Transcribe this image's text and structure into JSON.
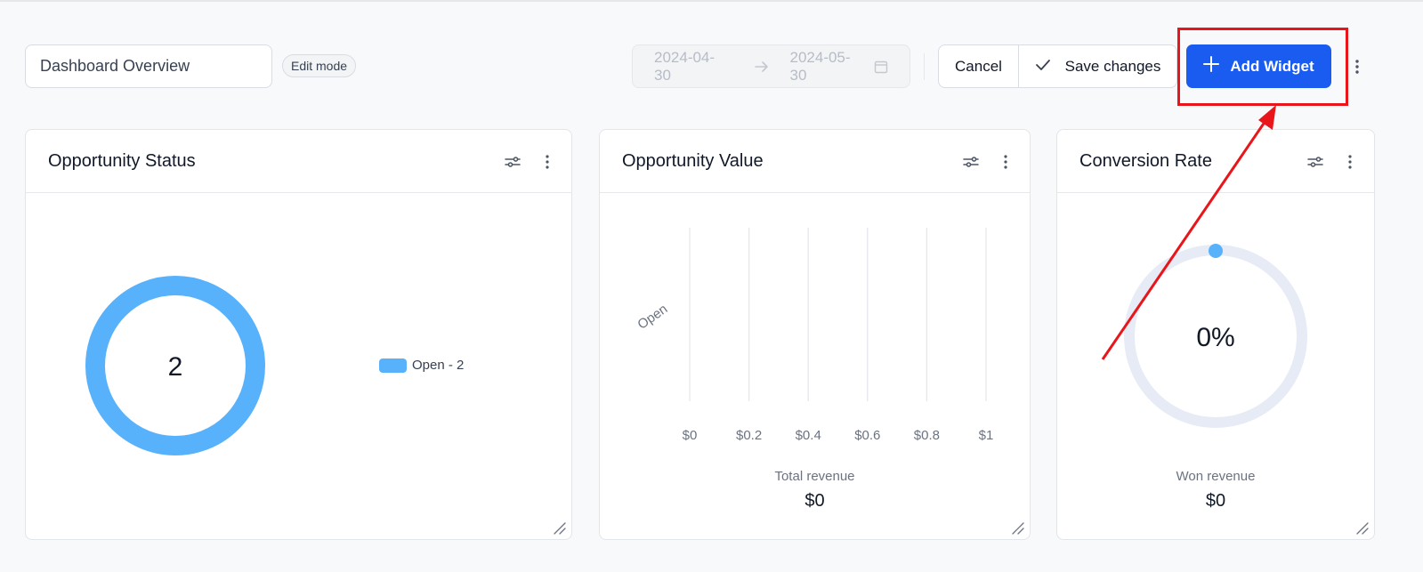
{
  "toolbar": {
    "title_value": "Dashboard Overview",
    "edit_badge": "Edit mode",
    "date_from": "2024-04-30",
    "date_to": "2024-05-30",
    "cancel_label": "Cancel",
    "save_label": "Save changes",
    "add_widget_label": "Add Widget",
    "icons": [
      "arrow-right-icon",
      "calendar-icon",
      "check-icon",
      "plus-icon",
      "more-vertical-icon"
    ]
  },
  "widgets": {
    "status": {
      "title": "Opportunity Status",
      "center_value": "2",
      "legend_label": "Open - 2"
    },
    "value": {
      "title": "Opportunity Value",
      "total_label": "Total revenue",
      "total_value": "$0"
    },
    "conversion": {
      "title": "Conversion Rate",
      "percent": "0%",
      "won_label": "Won revenue",
      "won_value": "$0"
    }
  },
  "chart_data": [
    {
      "type": "pie",
      "categories": [
        "Open"
      ],
      "values": [
        2
      ],
      "legend": [
        "Open - 2"
      ],
      "center_label": "2",
      "colors": [
        "#58b1fb"
      ]
    },
    {
      "type": "bar",
      "orientation": "horizontal",
      "categories": [
        "Open"
      ],
      "values": [
        0
      ],
      "xticks": [
        "$0",
        "$0.2",
        "$0.4",
        "$0.6",
        "$0.8",
        "$1"
      ],
      "xlim": [
        0,
        1
      ],
      "grid": true
    }
  ],
  "colors": {
    "accent": "#1a5cf0",
    "chart_blue": "#58b1fb",
    "ring_track": "#e6ebf6",
    "annotation_red": "#e8161b"
  }
}
